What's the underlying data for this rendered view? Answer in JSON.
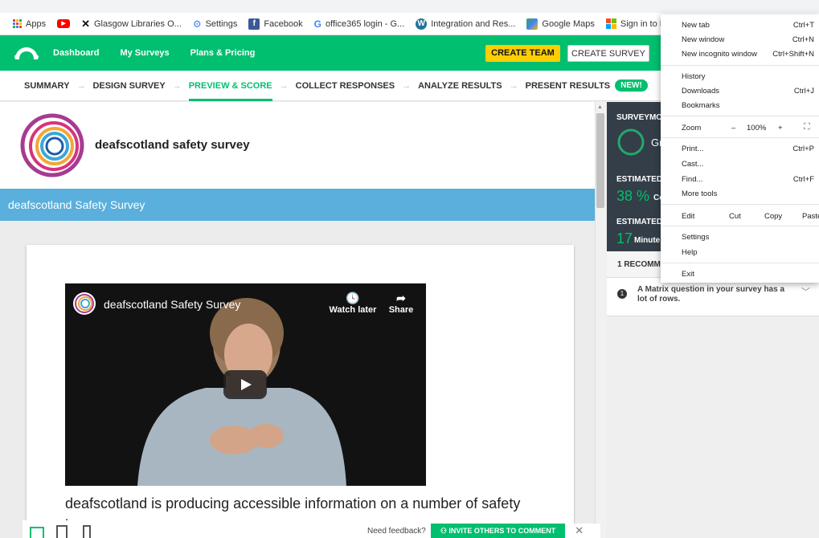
{
  "bookmarks": [
    {
      "label": "Apps",
      "icon": "apps-grid-icon",
      "color": "#ea4335"
    },
    {
      "label": "",
      "icon": "youtube-icon",
      "color": "#ff0000"
    },
    {
      "label": "Glasgow Libraries O...",
      "icon": "glasgow-x-icon",
      "color": "#000000"
    },
    {
      "label": "Settings",
      "icon": "gear-icon",
      "color": "#4285f4"
    },
    {
      "label": "Facebook",
      "icon": "facebook-icon",
      "color": "#3b5998"
    },
    {
      "label": "office365 login - G...",
      "icon": "google-g-icon",
      "color": "#4285f4"
    },
    {
      "label": "Integration and Res...",
      "icon": "wordpress-icon",
      "color": "#21759b"
    },
    {
      "label": "Google Maps",
      "icon": "maps-pin-icon",
      "color": "#34a853"
    },
    {
      "label": "Sign in to Microsoft...",
      "icon": "microsoft-icon",
      "color": "#f25022"
    }
  ],
  "nav": {
    "dashboard": "Dashboard",
    "my_surveys": "My Surveys",
    "plans": "Plans & Pricing",
    "create_team": "CREATE TEAM",
    "create_survey": "CREATE SURVEY"
  },
  "steps": [
    "SUMMARY",
    "DESIGN SURVEY",
    "PREVIEW & SCORE",
    "COLLECT RESPONSES",
    "ANALYZE RESULTS",
    "PRESENT RESULTS"
  ],
  "steps_new": "NEW!",
  "survey": {
    "title": "deafscotland safety survey",
    "page_title": "deafscotland Safety Survey",
    "video_title": "deafscotland Safety Survey",
    "watch_later": "Watch later",
    "share": "Share",
    "description": "deafscotland is producing accessible information on a number of safety issues."
  },
  "panel": {
    "score_head": "SURVEYMO",
    "score_word": "Gr",
    "est1_head": "ESTIMATED",
    "est1_value": "38 %",
    "est1_unit": "Co",
    "est2_head": "ESTIMATED",
    "est2_value": "17",
    "est2_unit": "Minute",
    "recommendations": "1 RECOMME",
    "rec_text": "A Matrix question in your survey has a lot of rows."
  },
  "menu": {
    "new_tab": "New tab",
    "new_tab_sc": "Ctrl+T",
    "new_window": "New window",
    "new_window_sc": "Ctrl+N",
    "incognito": "New incognito window",
    "incognito_sc": "Ctrl+Shift+N",
    "history": "History",
    "downloads": "Downloads",
    "downloads_sc": "Ctrl+J",
    "bookmarks": "Bookmarks",
    "zoom": "Zoom",
    "zoom_minus": "–",
    "zoom_value": "100%",
    "zoom_plus": "+",
    "print": "Print...",
    "print_sc": "Ctrl+P",
    "cast": "Cast...",
    "find": "Find...",
    "find_sc": "Ctrl+F",
    "more_tools": "More tools",
    "edit": "Edit",
    "cut": "Cut",
    "copy": "Copy",
    "paste": "Paste",
    "settings": "Settings",
    "help": "Help",
    "exit": "Exit"
  },
  "feedback": {
    "label": "Need feedback?",
    "invite": "INVITE OTHERS TO COMMENT"
  },
  "colors": {
    "brand_green": "#00bf6f",
    "page_bar": "#5aafdc",
    "panel_dark": "#333e48"
  }
}
